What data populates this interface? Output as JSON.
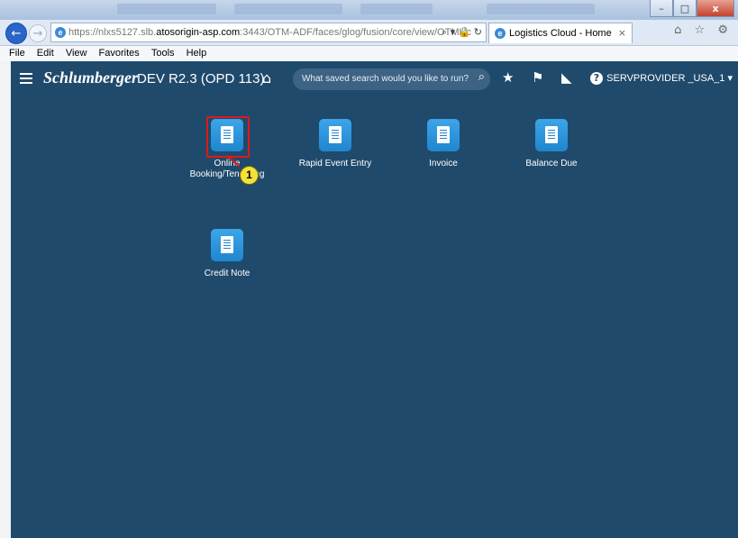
{
  "browser": {
    "url_prefix": "https://nlxs5127.slb.",
    "url_host": "atosorigin-asp.com",
    "url_rest": ":3443/OTM-ADF/faces/glog/fusion/core/view/OTMHc",
    "url_tools": "⌕ ▾ 🔒 ↻",
    "tab_title": "Logistics Cloud - Home",
    "tab_close": "×",
    "right_tools": "⌂ ☆ ⚙",
    "window_buttons": [
      "–",
      "□",
      "x"
    ]
  },
  "menubar": {
    "items": [
      "File",
      "Edit",
      "View",
      "Favorites",
      "Tools",
      "Help"
    ]
  },
  "app": {
    "brand": "Schlumberger",
    "environment": "DEV R2.3 (OPD 113)",
    "search_placeholder": "What saved search would you like to run?",
    "user": "SERVPROVIDER _USA_1 ▾"
  },
  "tiles": [
    {
      "label_line1": "Online",
      "label_line2": "Booking/Tendering"
    },
    {
      "label_line1": "Rapid Event Entry",
      "label_line2": ""
    },
    {
      "label_line1": "Invoice",
      "label_line2": ""
    },
    {
      "label_line1": "Balance Due",
      "label_line2": ""
    },
    {
      "label_line1": "Credit Note",
      "label_line2": ""
    }
  ],
  "callout": {
    "number": "1"
  },
  "colors": {
    "accent": "#1f86cf",
    "background": "#1f4a6c",
    "highlight": "#e01818"
  }
}
